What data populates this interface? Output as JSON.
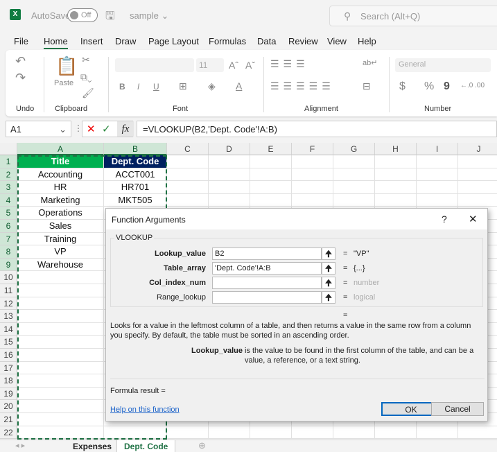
{
  "titlebar": {
    "logo": "X",
    "autosave_label": "AutoSave",
    "autosave_state": "Off",
    "save_icon": "save-icon",
    "filename": "sample",
    "search_placeholder": "Search (Alt+Q)"
  },
  "menu": [
    "File",
    "Home",
    "Insert",
    "Draw",
    "Page Layout",
    "Formulas",
    "Data",
    "Review",
    "View",
    "Help"
  ],
  "active_tab": "Home",
  "ribbon": {
    "groups": [
      "Undo",
      "Clipboard",
      "Font",
      "Alignment",
      "Number"
    ],
    "paste_label": "Paste",
    "font_size": "11",
    "number_format": "General",
    "bold": "B",
    "italic": "I",
    "underline": "U",
    "currency": "$",
    "percent": "%",
    "comma": "9"
  },
  "formula_bar": {
    "name_box": "A1",
    "formula": "=VLOOKUP(B2,'Dept. Code'!A:B)",
    "fx": "fx"
  },
  "columns": [
    "A",
    "B",
    "C",
    "D",
    "E",
    "F",
    "G",
    "H",
    "I",
    "J"
  ],
  "rows": [
    "1",
    "2",
    "3",
    "4",
    "5",
    "6",
    "7",
    "8",
    "9",
    "10",
    "11",
    "12",
    "13",
    "14",
    "15",
    "16",
    "17",
    "18",
    "19",
    "20",
    "21",
    "22"
  ],
  "table": {
    "headers": [
      "Title",
      "Dept. Code"
    ],
    "header_color": "#00b050",
    "header2_color": "#002060",
    "data": [
      [
        "Accounting",
        "ACCT001"
      ],
      [
        "HR",
        "HR701"
      ],
      [
        "Marketing",
        "MKT505"
      ],
      [
        "Operations",
        ""
      ],
      [
        "Sales",
        ""
      ],
      [
        "Training",
        ""
      ],
      [
        "VP",
        ""
      ],
      [
        "Warehouse",
        ""
      ]
    ]
  },
  "sheet_tabs": [
    "Expenses",
    "Dept. Code"
  ],
  "active_sheet": "Dept. Code",
  "dialog": {
    "title": "Function Arguments",
    "help": "?",
    "close": "✕",
    "function": "VLOOKUP",
    "args": [
      {
        "label": "Lookup_value",
        "value": "B2",
        "result": "\"VP\"",
        "hint": false,
        "bold": true
      },
      {
        "label": "Table_array",
        "value": "'Dept. Code'!A:B",
        "result": "{...}",
        "hint": false,
        "bold": true
      },
      {
        "label": "Col_index_num",
        "value": "",
        "result": "number",
        "hint": true,
        "bold": true
      },
      {
        "label": "Range_lookup",
        "value": "",
        "result": "logical",
        "hint": true,
        "bold": false
      }
    ],
    "eq": "=",
    "description": "Looks for a value in the leftmost column of a table, and then returns a value in the same row from a column you specify. By default, the table must be sorted in an ascending order.",
    "arg_name": "Lookup_value",
    "arg_desc": "is the value to be found in the first column of the table, and can be a value, a reference, or a text string.",
    "formula_result": "Formula result =",
    "help_link": "Help on this function",
    "ok": "OK",
    "cancel": "Cancel"
  }
}
